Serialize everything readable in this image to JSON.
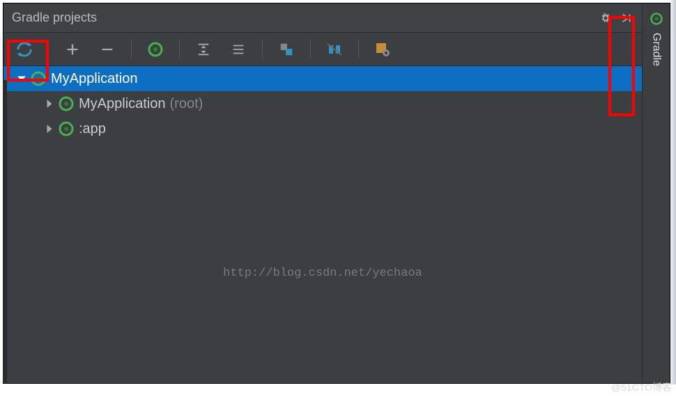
{
  "header": {
    "title": "Gradle projects"
  },
  "sidebar": {
    "label": "Gradle"
  },
  "tree": {
    "root": {
      "label": "MyApplication",
      "children": [
        {
          "label": "MyApplication",
          "suffix": "(root)"
        },
        {
          "label": ":app"
        }
      ]
    }
  },
  "watermark": "http://blog.csdn.net/yechaoa",
  "credit": "@51CTO博客"
}
